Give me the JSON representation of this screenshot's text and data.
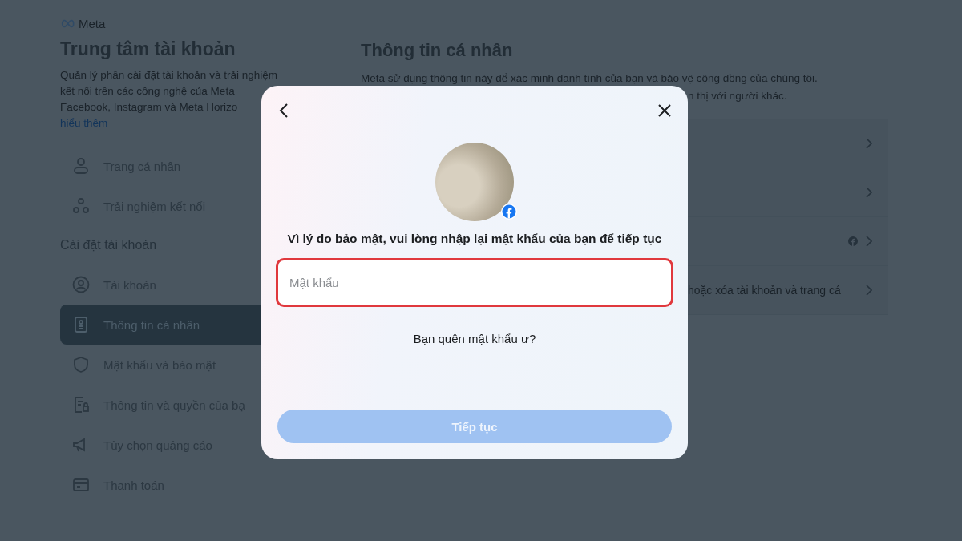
{
  "brand": "Meta",
  "sidebar": {
    "title": "Trung tâm tài khoản",
    "description": [
      "Quản lý phần cài đặt tài khoản và trải nghiệm",
      "kết nối trên các công nghệ của Meta",
      "Facebook, Instagram và Meta Horizo"
    ],
    "learn_more": "hiểu thêm",
    "items": [
      {
        "kind": "item",
        "label": "Trang cá nhân",
        "selected": false
      },
      {
        "kind": "item",
        "label": "Trải nghiệm kết nối",
        "selected": false
      },
      {
        "kind": "heading",
        "label": "Cài đặt tài khoản"
      },
      {
        "kind": "item",
        "label": "Tài khoản",
        "selected": false
      },
      {
        "kind": "item",
        "label": "Thông tin cá nhân",
        "selected": true
      },
      {
        "kind": "item",
        "label": "Mật khẩu và bảo mật",
        "selected": false
      },
      {
        "kind": "item",
        "label": "Thông tin và quyền của bạ",
        "selected": false
      },
      {
        "kind": "item",
        "label": "Tùy chọn quảng cáo",
        "selected": false
      },
      {
        "kind": "item",
        "label": "Thanh toán",
        "selected": false
      }
    ]
  },
  "main": {
    "title": "Thông tin cá nhân",
    "description": "Meta sử dụng thông tin này để xác minh danh tính của bạn và bảo vệ cộng đồng của chúng tôi.",
    "description_tail": "n thị với người khác.",
    "rows": [
      {
        "kind": "plain"
      },
      {
        "kind": "plain"
      },
      {
        "kind": "badge"
      },
      {
        "kind": "text",
        "text": "hoặc xóa tài khoản và trang cá"
      }
    ]
  },
  "modal": {
    "prompt": "Vì lý do bảo mật, vui lòng nhập lại mật khẩu của bạn để tiếp tục",
    "password_field": {
      "placeholder": "Mật khẩu",
      "highlighted": true
    },
    "forgot_link": "Bạn quên mật khẩu ư?",
    "submit": {
      "label": "Tiếp tục",
      "disabled": true
    }
  }
}
